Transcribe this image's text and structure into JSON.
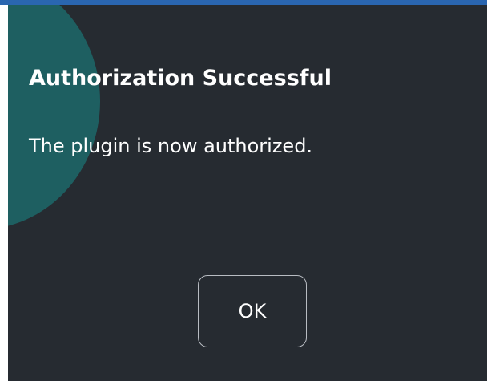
{
  "dialog": {
    "title": "Authorization Successful",
    "message": "The plugin is now authorized.",
    "ok_label": "OK"
  },
  "colors": {
    "background": "#262b31",
    "accent_circle": "#1e5f61",
    "top_border": "#2a66b0",
    "text": "#ffffff",
    "button_border": "#b8bcc2"
  }
}
